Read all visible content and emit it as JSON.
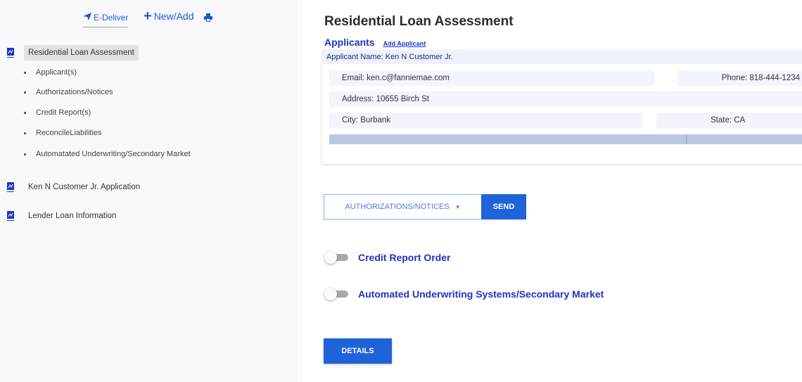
{
  "toolbar": {
    "edeliver_label": "E-Deliver",
    "new_add_label": "New/Add",
    "icons": [
      "paper-plane-icon",
      "plus-icon",
      "printer-icon"
    ]
  },
  "tree": {
    "nodes": [
      {
        "label": "Residential Loan Assessment",
        "selected": true,
        "children": [
          "Applicant(s)",
          "Authorizations/Notices",
          "Credit Report(s)",
          "ReconcileLiabilities",
          "Automatated Underwriting/Secondary Market"
        ]
      },
      {
        "label": "Ken N Customer Jr. Application"
      },
      {
        "label": "Lender Loan Information"
      }
    ]
  },
  "main": {
    "title": "Residential Loan Assessment",
    "applicants_title": "Applicants",
    "add_applicant_label": "Add Applicant",
    "applicant": {
      "name_line": "Applicant Name: Ken N Customer Jr.",
      "email_line": "Email: ken.c@fanniemae.com",
      "phone_line": "Phone: 818-444-1234",
      "address_line": "Address: 10655 Birch St",
      "city_line": "City: Burbank",
      "state_line": "State: CA"
    },
    "dropdown_label": "AUTHORIZATIONS/NOTICES",
    "send_label": "SEND",
    "toggles": [
      {
        "label": "Credit Report Order",
        "on": false
      },
      {
        "label": "Automated Underwriting Systems/Secondary Market",
        "on": false
      }
    ],
    "details_label": "DETAILS"
  },
  "colors": {
    "accent_blue": "#1f63d9",
    "link_blue": "#1a35c7",
    "sidebar_bg": "#f8f9fb",
    "selected_bg": "#e2e2e2"
  }
}
